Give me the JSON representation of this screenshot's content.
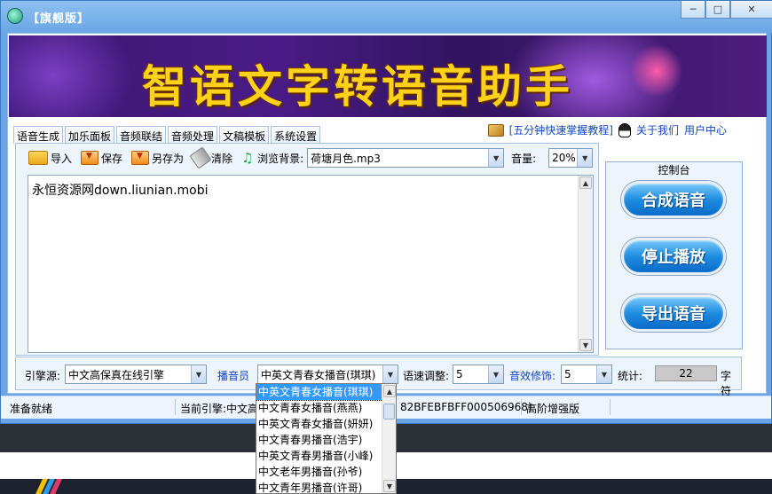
{
  "window": {
    "title": "【旗舰版】",
    "minimize": "─",
    "maximize": "□",
    "close": "✕"
  },
  "banner": {
    "title": "智语文字转语音助手"
  },
  "tabs": [
    "语音生成",
    "加乐面板",
    "音频联结",
    "音频处理",
    "文稿模板",
    "系统设置"
  ],
  "links": {
    "tutorial": "[五分钟快速掌握教程]",
    "about": "关于我们",
    "user_center": "用户中心"
  },
  "toolbar": {
    "import": "导入",
    "save": "保存",
    "save_as": "另存为",
    "clear": "清除",
    "browse_bg": "浏览背景:",
    "bg_file": "荷塘月色.mp3",
    "volume_label": "音量:",
    "volume_value": "20%"
  },
  "editor": {
    "text": "永恒资源网down.liunian.mobi"
  },
  "control_panel": {
    "title": "控制台",
    "synthesize": "合成语音",
    "stop": "停止播放",
    "export": "导出语音"
  },
  "settings": {
    "engine_label": "引擎源:",
    "engine_value": "中文高保真在线引擎",
    "announcer_label": "播音员",
    "announcer_value": "中英文青春女播音(琪琪)",
    "speed_label": "语速调整:",
    "speed_value": "5",
    "effect_label": "音效修饰:",
    "effect_value": "5",
    "stats_label": "统计:",
    "stats_value": "22",
    "stats_unit": "字符"
  },
  "status": {
    "ready": "准备就绪",
    "engine": "当前引擎:中文高",
    "code": "82BFEBFBFF000506968)",
    "mode": "高阶增强版"
  },
  "announcer_options": [
    "中英文青春女播音(琪琪)",
    "中文青春女播音(燕燕)",
    "中英文青春女播音(妍妍)",
    "中文青春男播音(浩宇)",
    "中英文青春男播音(小峰)",
    "中文老年男播音(孙爷)",
    "中文青年男播音(许哥)"
  ]
}
